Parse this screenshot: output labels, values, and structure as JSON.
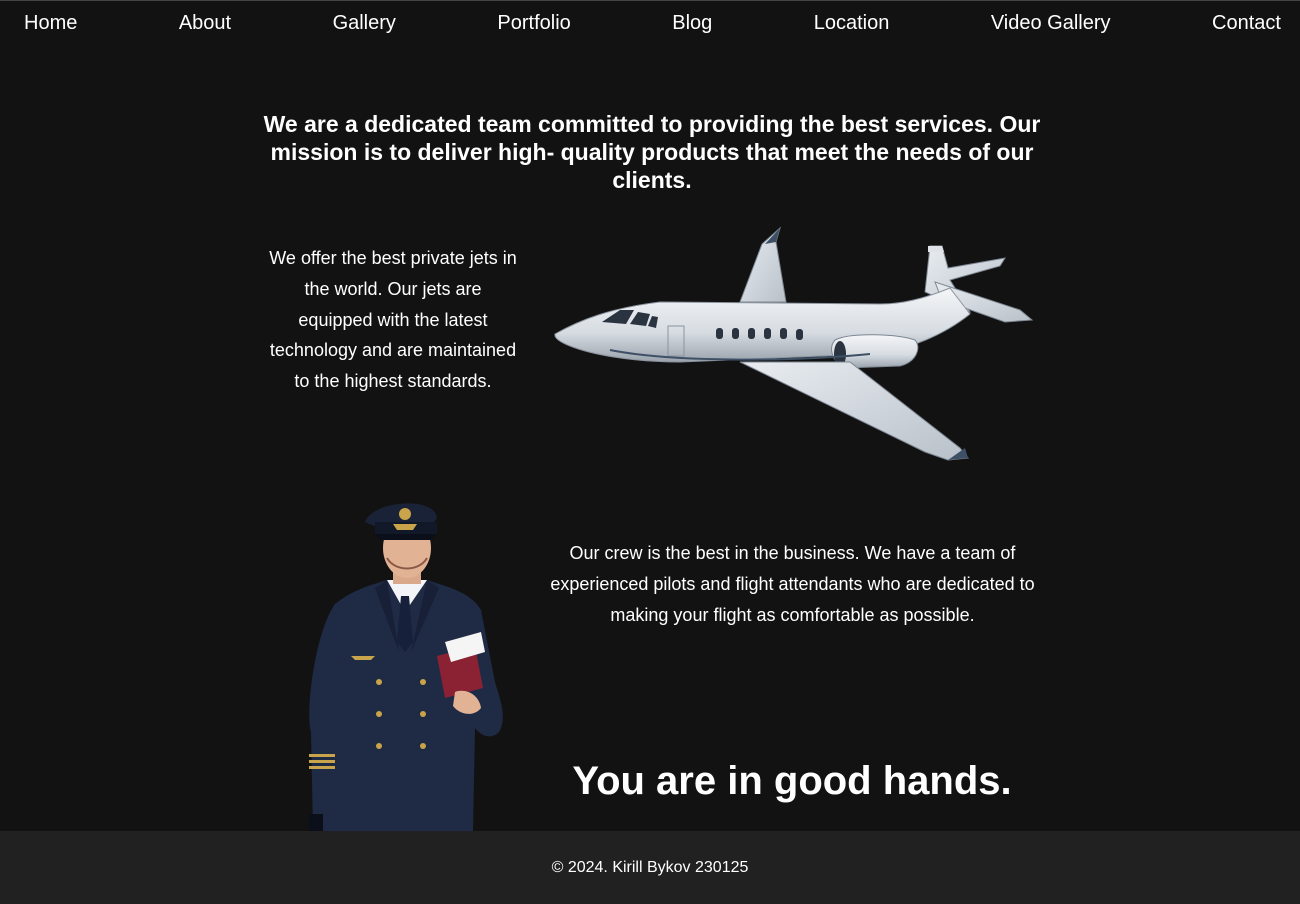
{
  "nav": {
    "items": [
      "Home",
      "About",
      "Gallery",
      "Portfolio",
      "Blog",
      "Location",
      "Video Gallery",
      "Contact"
    ]
  },
  "main": {
    "mission": "We are a dedicated team committed to providing the best services. Our mission is to deliver high- quality products that meet the needs of our clients.",
    "jets_text": "We offer the best private jets in the world. Our jets are equipped with the latest technology and are maintained to the highest standards.",
    "crew_text": "Our crew is the best in the business. We have a team of experienced pilots and flight attendants who are dedicated to making your flight as comfortable as possible.",
    "tagline": "You are in good hands."
  },
  "footer": {
    "text": "© 2024. Kirill Bykov 230125"
  },
  "images": {
    "jet": "private-jet-image",
    "pilot": "pilot-image"
  },
  "colors": {
    "background": "#121212",
    "footer_background": "#212121",
    "text": "#ffffff"
  }
}
